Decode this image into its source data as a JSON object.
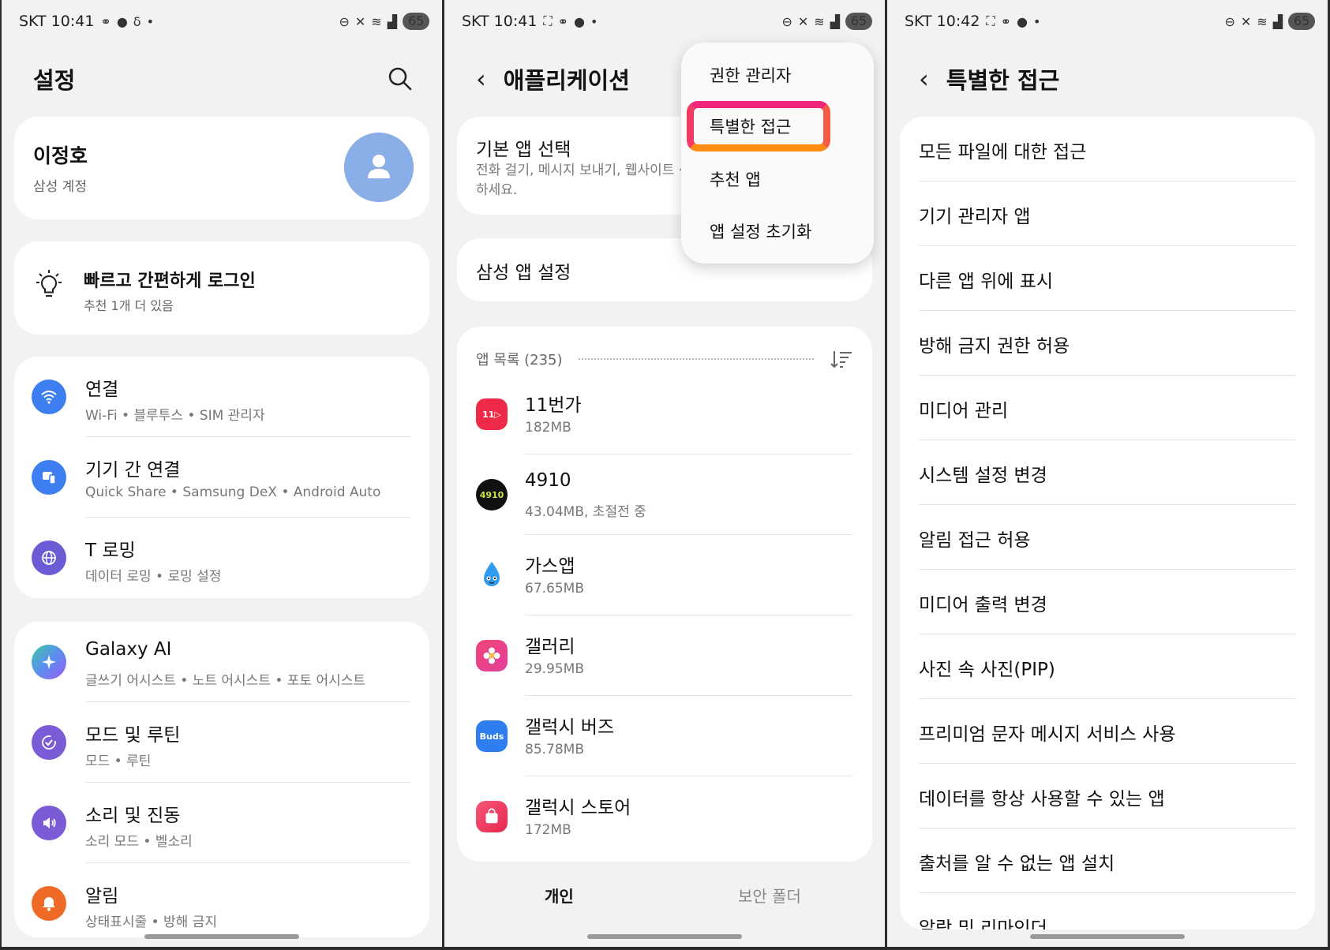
{
  "status_bars": [
    {
      "carrier": "SKT",
      "time": "10:41",
      "battery": "65"
    },
    {
      "carrier": "SKT",
      "time": "10:41",
      "battery": "65"
    },
    {
      "carrier": "SKT",
      "time": "10:42",
      "battery": "65"
    }
  ],
  "settings": {
    "title": "설정",
    "profile": {
      "name": "이정호",
      "account": "삼성 계정"
    },
    "tip": {
      "title": "빠르고 간편하게 로그인",
      "subtitle": "추천 1개 더 있음"
    },
    "group1": [
      {
        "title": "연결",
        "subtitle": "Wi-Fi • 블루투스 • SIM 관리자",
        "icon": "wifi-icon",
        "color": "#3d7ef0"
      },
      {
        "title": "기기 간 연결",
        "subtitle": "Quick Share • Samsung DeX • Android Auto",
        "icon": "devices-icon",
        "color": "#3d7ef0"
      },
      {
        "title": "T 로밍",
        "subtitle": "데이터 로밍 • 로밍 설정",
        "icon": "globe-icon",
        "color": "#6b5cd6"
      }
    ],
    "group2": [
      {
        "title": "Galaxy AI",
        "subtitle": "글쓰기 어시스트 • 노트 어시스트 • 포토 어시스트",
        "icon": "sparkle-icon",
        "color": "#5b8ef0"
      },
      {
        "title": "모드 및 루틴",
        "subtitle": "모드 • 루틴",
        "icon": "routine-icon",
        "color": "#7b5cd6"
      },
      {
        "title": "소리 및 진동",
        "subtitle": "소리 모드 • 벨소리",
        "icon": "speaker-icon",
        "color": "#7b5cd6"
      },
      {
        "title": "알림",
        "subtitle": "상태표시줄 • 방해 금지",
        "icon": "bell-icon",
        "color": "#ef6a27"
      }
    ]
  },
  "applications": {
    "title": "애플리케이션",
    "default_apps": {
      "title": "기본 앱 선택",
      "subtitle": "전화 걸기, 메시지 보내기, 웹사이트 선택하세요."
    },
    "samsung_settings": "삼성 앱 설정",
    "app_list_label": "앱 목록 (235)",
    "apps": [
      {
        "name": "11번가",
        "size": "182MB",
        "icon_label": "11▷",
        "color": "#ef2a49"
      },
      {
        "name": "4910",
        "size": "43.04MB, 초절전 중",
        "icon_label": "4910",
        "color": "#111111"
      },
      {
        "name": "가스앱",
        "size": "67.65MB",
        "icon_label": "",
        "color": "#2f9bf0"
      },
      {
        "name": "갤러리",
        "size": "29.95MB",
        "icon_label": "",
        "color": "#f0457a"
      },
      {
        "name": "갤럭시 버즈",
        "size": "85.78MB",
        "icon_label": "Buds",
        "color": "#2f7ef0"
      },
      {
        "name": "갤럭시 스토어",
        "size": "172MB",
        "icon_label": "",
        "color": "#ef3d6a"
      }
    ],
    "tabs": {
      "personal": "개인",
      "secure_folder": "보안 폴더"
    },
    "menu": [
      "권한 관리자",
      "특별한 접근",
      "추천 앱",
      "앱 설정 초기화"
    ]
  },
  "special_access": {
    "title": "특별한 접근",
    "items": [
      "모든 파일에 대한 접근",
      "기기 관리자 앱",
      "다른 앱 위에 표시",
      "방해 금지 권한 허용",
      "미디어 관리",
      "시스템 설정 변경",
      "알림 접근 허용",
      "미디어 출력 변경",
      "사진 속 사진(PIP)",
      "프리미엄 문자 메시지 서비스 사용",
      "데이터를 항상 사용할 수 있는 앱",
      "출처를 알 수 없는 앱 설치",
      "알람 및 리마인더"
    ]
  }
}
